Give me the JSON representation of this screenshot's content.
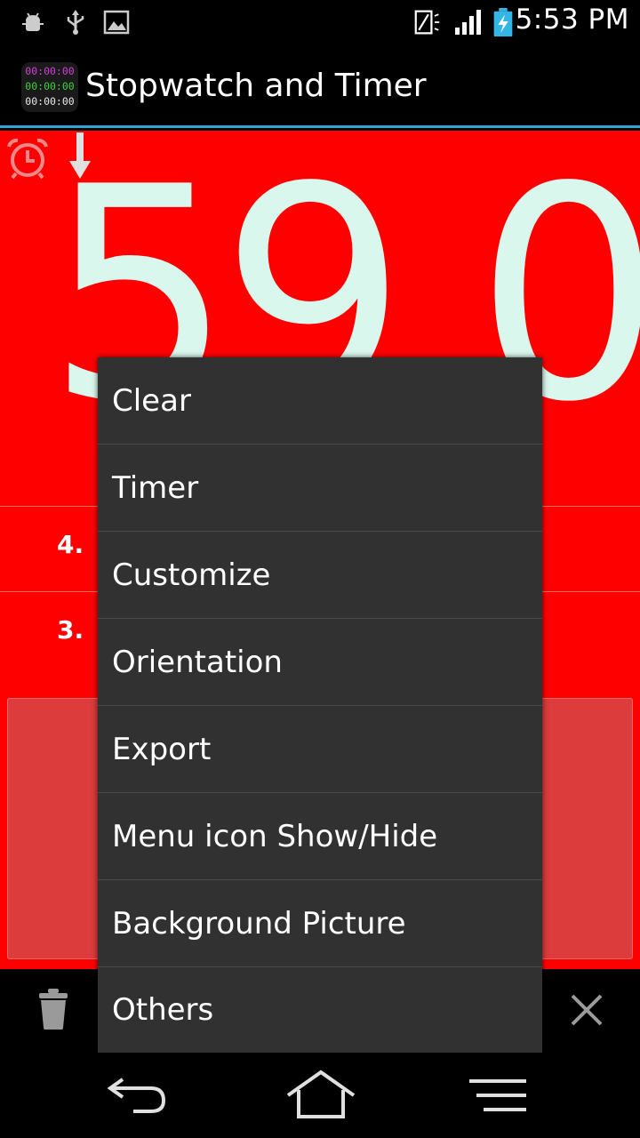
{
  "status_bar": {
    "time": "5:53 PM",
    "icons": [
      "android-debug-icon",
      "usb-icon",
      "image-notification-icon",
      "nfc-icon",
      "signal-icon",
      "battery-charging-icon"
    ]
  },
  "action_bar": {
    "title": "Stopwatch and Timer",
    "app_icon_lines": [
      "00:00:00",
      "00:00:00",
      "00:00:00"
    ]
  },
  "display": {
    "time": "59.0"
  },
  "laps": [
    {
      "number": "4."
    },
    {
      "number": "3."
    }
  ],
  "menu": {
    "items": [
      "Clear",
      "Timer",
      "Customize",
      "Orientation",
      "Export",
      "Menu icon Show/Hide",
      "Background Picture",
      "Others"
    ]
  },
  "colors": {
    "background": "#ff0000",
    "time_text": "#daf7ed",
    "button": "#dc3c3c",
    "menu_background": "#313131",
    "accent_line": "#33a5d9"
  }
}
